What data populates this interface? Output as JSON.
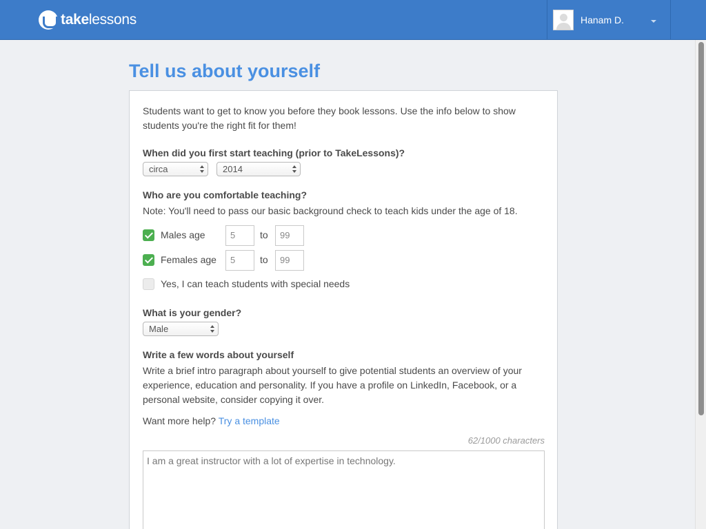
{
  "header": {
    "logo_prefix": "take",
    "logo_suffix": "lessons",
    "user_name": "Hanam D."
  },
  "page": {
    "title": "Tell us about yourself",
    "intro": "Students want to get to know you before they book lessons. Use the info below to show students you're the right fit for them!"
  },
  "teaching_start": {
    "label": "When did you first start teaching (prior to TakeLessons)?",
    "qualifier": "circa",
    "year": "2014"
  },
  "comfort": {
    "label": "Who are you comfortable teaching?",
    "note": "Note: You'll need to pass our basic background check to teach kids under the age of 18.",
    "males_label": "Males age",
    "males_min": "5",
    "males_max": "99",
    "females_label": "Females age",
    "females_min": "5",
    "females_max": "99",
    "to": "to",
    "special_needs_label": "Yes, I can teach students with special needs",
    "males_checked": true,
    "females_checked": true,
    "special_needs_checked": false
  },
  "gender": {
    "label": "What is your gender?",
    "value": "Male"
  },
  "about": {
    "label": "Write a few words about yourself",
    "description": "Write a brief intro paragraph about yourself to give potential students an overview of your experience, education and personality. If you have a profile on LinkedIn, Facebook, or a personal website, consider copying it over.",
    "help_prefix": "Want more help?",
    "help_link": "Try a template",
    "counter": "62/1000 characters",
    "text": "I am a great instructor with a lot of expertise in technology."
  },
  "colors": {
    "header_blue": "#3d7cc9",
    "title_blue": "#4a90e2",
    "check_green": "#4caf50"
  }
}
